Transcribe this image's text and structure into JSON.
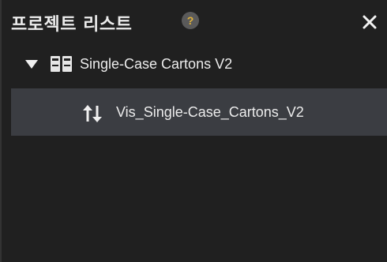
{
  "panel": {
    "title": "프로젝트 리스트",
    "help_label": "?",
    "close_icon": "close-icon"
  },
  "tree": {
    "project": {
      "label": "Single-Case Cartons V2",
      "expanded": true,
      "icon": "project-binder-icon"
    },
    "children": [
      {
        "label": "Vis_Single-Case_Cartons_V2",
        "icon": "up-down-arrows-icon",
        "selected": true
      }
    ]
  },
  "colors": {
    "background": "#202020",
    "selected_row": "#3b3d42",
    "help_badge": "#5a5a5a",
    "help_mark": "#e0b23b",
    "text": "#ececec"
  }
}
